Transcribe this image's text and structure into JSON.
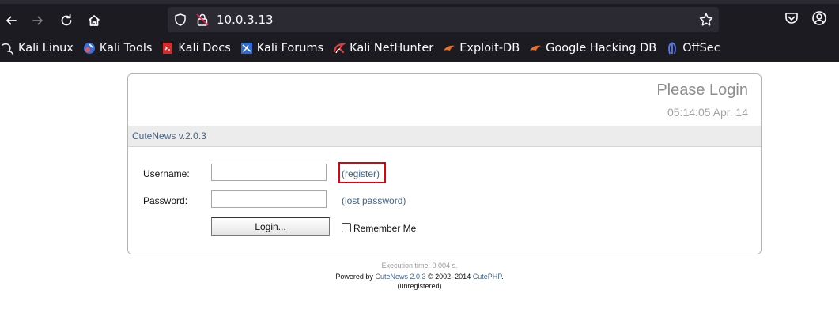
{
  "browser": {
    "url": "10.0.3.13",
    "bookmarks": [
      {
        "label": "Kali Linux",
        "icon": "kali-dragon-icon"
      },
      {
        "label": "Kali Tools",
        "icon": "kali-tools-icon"
      },
      {
        "label": "Kali Docs",
        "icon": "kali-docs-icon"
      },
      {
        "label": "Kali Forums",
        "icon": "kali-forums-icon"
      },
      {
        "label": "Kali NetHunter",
        "icon": "kali-nethunter-icon"
      },
      {
        "label": "Exploit-DB",
        "icon": "exploit-db-icon"
      },
      {
        "label": "Google Hacking DB",
        "icon": "ghdb-icon"
      },
      {
        "label": "OffSec",
        "icon": "offsec-icon"
      }
    ]
  },
  "login": {
    "title": "Please Login",
    "datetime": "05:14:05 Apr, 14",
    "version": "CuteNews v.2.0.3",
    "username_label": "Username:",
    "username_value": "",
    "password_label": "Password:",
    "password_value": "",
    "register_link": "(register)",
    "lost_password_link": "(lost password)",
    "login_button": "Login...",
    "remember_label": "Remember Me"
  },
  "footer": {
    "execution": "Execution time: 0.004 s.",
    "powered_prefix": "Powered by",
    "powered_link": "CuteNews 2.0.3",
    "copyright": "© 2002–2014",
    "cutephp_link": "CutePHP",
    "period": ".",
    "unregistered": "(unregistered)"
  },
  "colors": {
    "chrome_bg": "#1c1b22",
    "urlbar_bg": "#2b2a33",
    "link": "#42648e",
    "highlight": "#e0000e"
  }
}
